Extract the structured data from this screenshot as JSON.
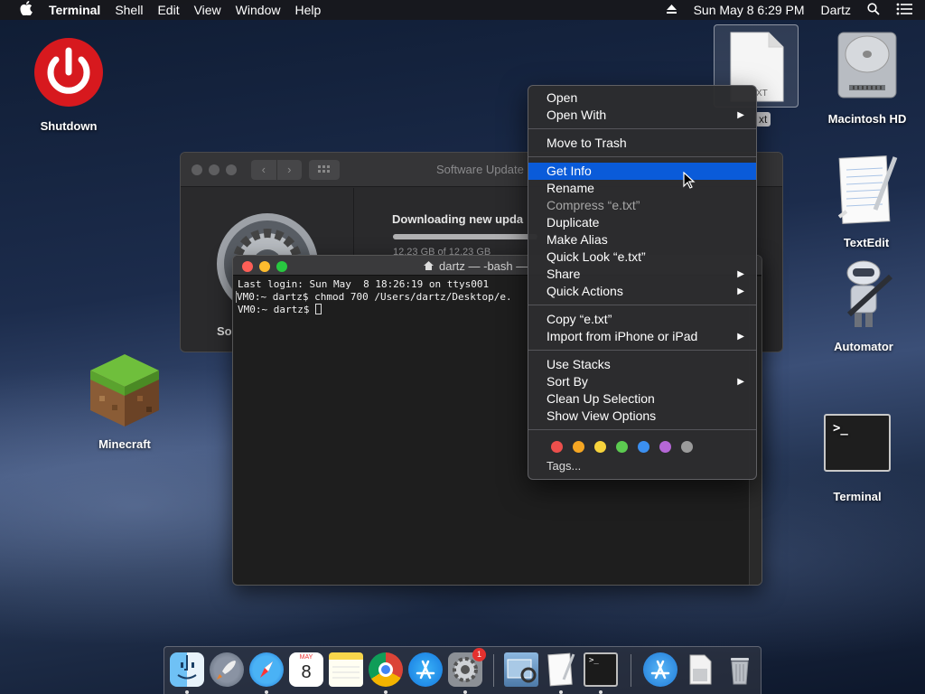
{
  "menubar": {
    "app": "Terminal",
    "items": [
      "Shell",
      "Edit",
      "View",
      "Window",
      "Help"
    ],
    "datetime": "Sun May 8  6:29 PM",
    "user": "Dartz"
  },
  "desktop": {
    "shutdown": "Shutdown",
    "minecraft": "Minecraft",
    "file_label_partial": "xt",
    "file_icon_text": "XT",
    "macintosh_hd": "Macintosh HD",
    "textedit": "TextEdit",
    "automator": "Automator",
    "terminal": "Terminal"
  },
  "software_update": {
    "title": "Software Update",
    "status": "Downloading new upda",
    "progress_text": "12.23 GB of 12.23 GB",
    "side_label": "So"
  },
  "terminal_window": {
    "title": "dartz — -bash —",
    "lines": [
      "Last login: Sun May  8 18:26:19 on ttys001",
      "VM0:~ dartz$ chmod 700 /Users/dartz/Desktop/e.",
      "VM0:~ dartz$ "
    ]
  },
  "context_menu": {
    "open": "Open",
    "open_with": "Open With",
    "move_to_trash": "Move to Trash",
    "get_info": "Get Info",
    "rename": "Rename",
    "compress": "Compress “e.txt”",
    "duplicate": "Duplicate",
    "make_alias": "Make Alias",
    "quick_look": "Quick Look “e.txt”",
    "share": "Share",
    "quick_actions": "Quick Actions",
    "copy": "Copy “e.txt”",
    "import": "Import from iPhone or iPad",
    "use_stacks": "Use Stacks",
    "sort_by": "Sort By",
    "clean_up": "Clean Up Selection",
    "show_view_options": "Show View Options",
    "tags_label": "Tags...",
    "tag_colors": [
      "#ec4f4c",
      "#f5a623",
      "#f7d33c",
      "#5ccb50",
      "#3b8fef",
      "#b567d6",
      "#9b9b9b"
    ]
  },
  "dock": {
    "calendar_month": "MAY",
    "calendar_day": "8",
    "badge": "1"
  }
}
